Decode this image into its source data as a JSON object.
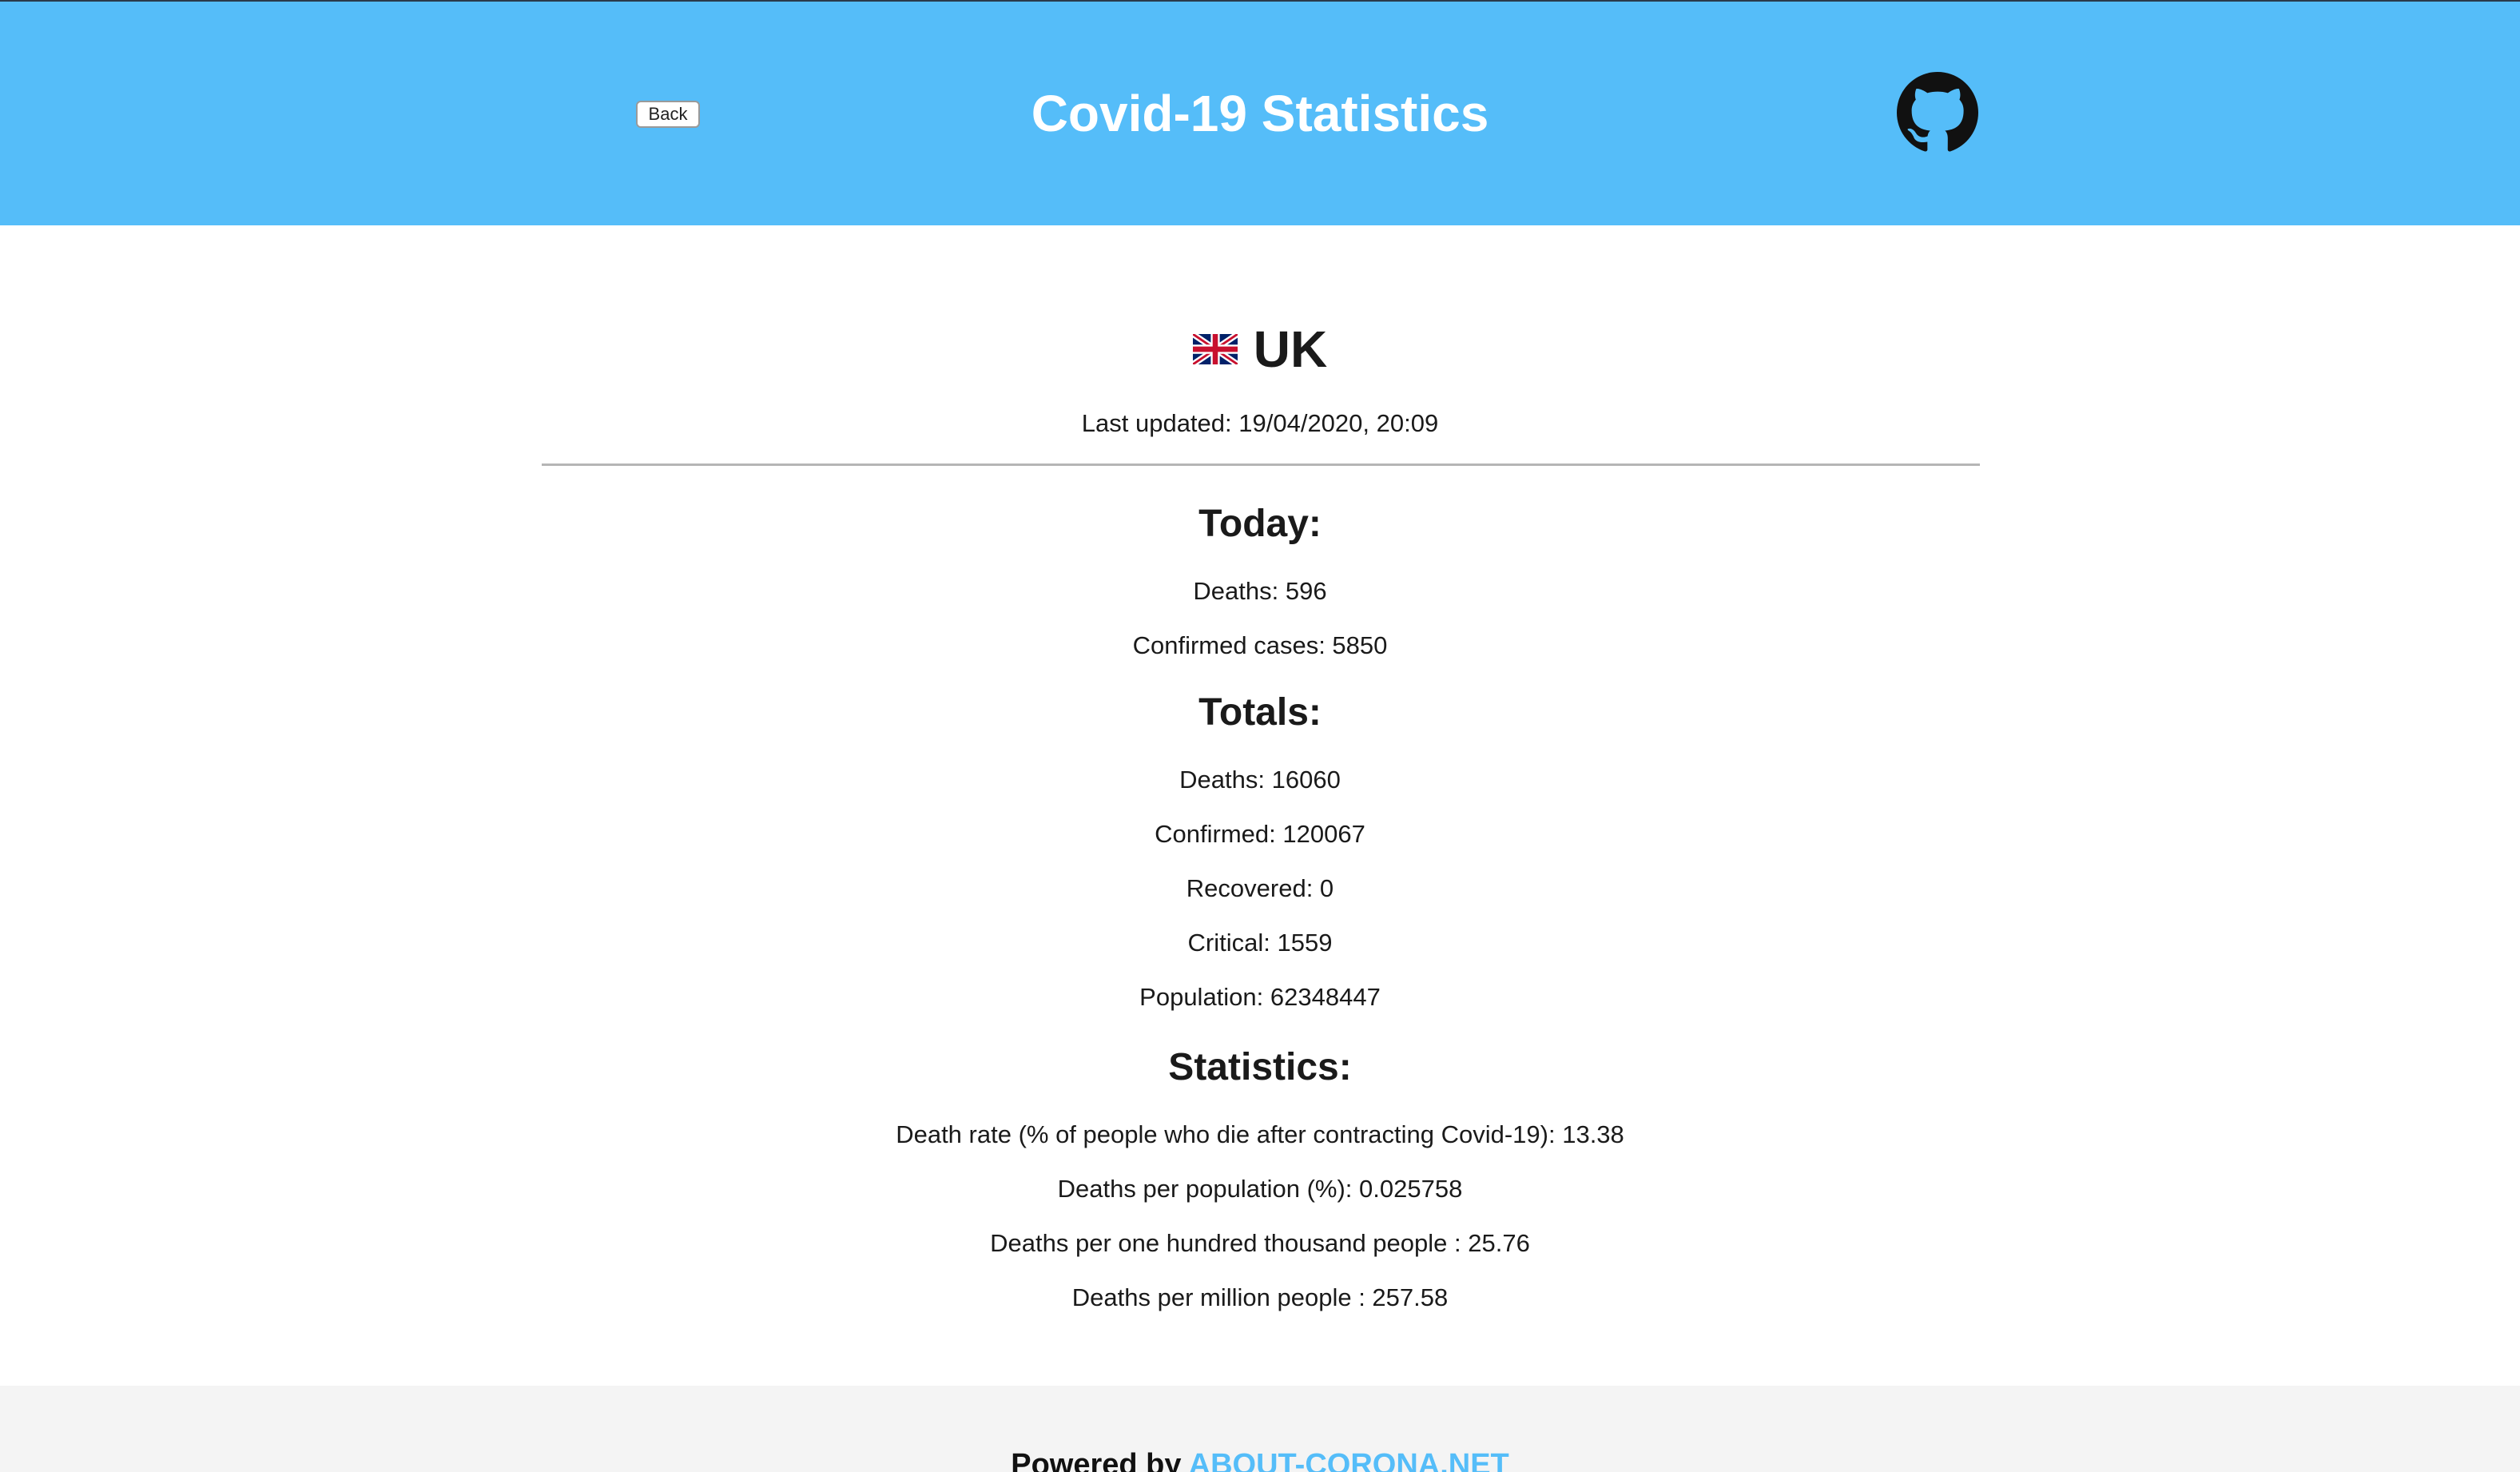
{
  "header": {
    "back_label": "Back",
    "title": "Covid-19 Statistics",
    "github_icon": "github-icon",
    "bg_color": "#55bdf9"
  },
  "country": {
    "flag_icon": "uk-flag-icon",
    "name": "UK",
    "last_updated": "Last updated: 19/04/2020, 20:09"
  },
  "today": {
    "heading": "Today:",
    "deaths": "Deaths: 596",
    "confirmed": "Confirmed cases: 5850"
  },
  "totals": {
    "heading": "Totals:",
    "deaths": "Deaths: 16060",
    "confirmed": "Confirmed: 120067",
    "recovered": "Recovered: 0",
    "critical": "Critical: 1559",
    "population": "Population: 62348447"
  },
  "statistics": {
    "heading": "Statistics:",
    "death_rate": "Death rate (% of people who die after contracting Covid-19): 13.38",
    "deaths_per_population": "Deaths per population (%): 0.025758",
    "deaths_per_100k": "Deaths per one hundred thousand people : 25.76",
    "deaths_per_million": "Deaths per million people : 257.58"
  },
  "footer": {
    "powered_by": "Powered by",
    "link_text": "ABOUT-CORONA.NET",
    "link_color": "#55bdf9"
  }
}
